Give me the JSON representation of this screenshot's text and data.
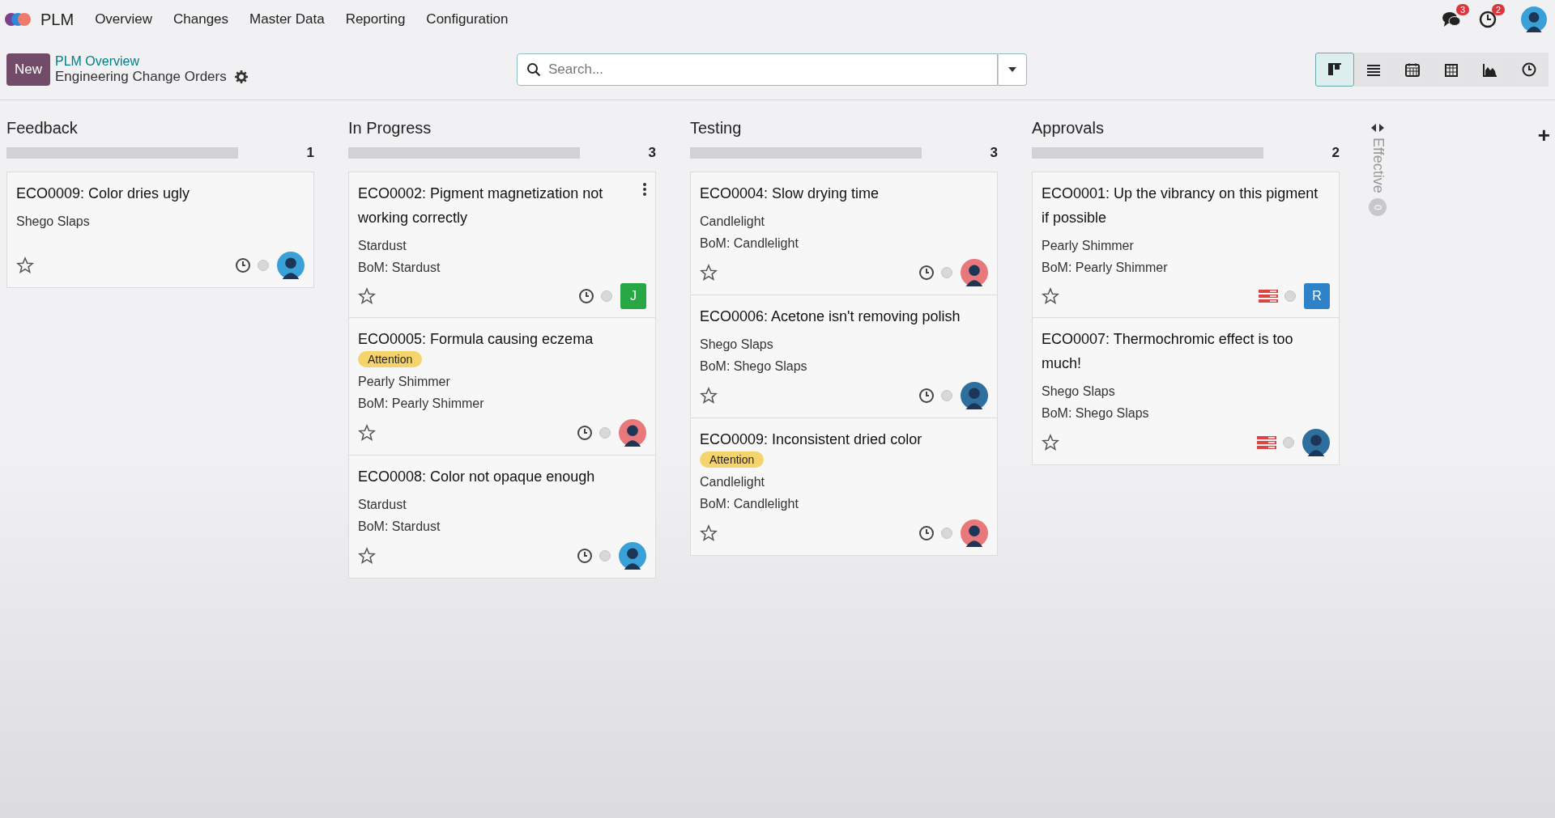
{
  "navbar": {
    "app": "PLM",
    "menu": [
      "Overview",
      "Changes",
      "Master Data",
      "Reporting",
      "Configuration"
    ],
    "messages_badge": "3",
    "activities_badge": "2"
  },
  "control_panel": {
    "new_button": "New",
    "breadcrumb": "PLM Overview",
    "title": "Engineering Change Orders",
    "search": {
      "placeholder": "Search..."
    },
    "views": [
      {
        "kind": "kanban",
        "selected": true
      },
      {
        "kind": "list",
        "selected": false
      },
      {
        "kind": "calendar",
        "selected": false
      },
      {
        "kind": "pivot",
        "selected": false
      },
      {
        "kind": "graph",
        "selected": false
      },
      {
        "kind": "activity",
        "selected": false
      }
    ]
  },
  "columns": [
    {
      "name": "Feedback",
      "count": "1",
      "level": 0,
      "cards": [
        {
          "title": "ECO0009: Color dries ugly",
          "product": "Shego Slaps",
          "menu": false,
          "activity": {
            "kind": "clock"
          },
          "avatar": {
            "kind": "photo",
            "color": "#3aa0d8"
          }
        }
      ]
    },
    {
      "name": "In Progress",
      "count": "3",
      "level": 0,
      "cards": [
        {
          "title": "ECO0002: Pigment magnetization not working correctly",
          "product": "Stardust",
          "bom": "BoM: Stardust",
          "menu": true,
          "activity": {
            "kind": "clock"
          },
          "avatar": {
            "kind": "letter",
            "letter": "J",
            "color": "#28a745"
          }
        },
        {
          "title": "ECO0005: Formula causing eczema",
          "tag": "Attention",
          "product": "Pearly Shimmer",
          "bom": "BoM: Pearly Shimmer",
          "menu": false,
          "activity": {
            "kind": "clock"
          },
          "avatar": {
            "kind": "photo",
            "color": "#e8787a"
          }
        },
        {
          "title": "ECO0008: Color not opaque enough",
          "product": "Stardust",
          "bom": "BoM: Stardust",
          "menu": false,
          "activity": {
            "kind": "clock"
          },
          "avatar": {
            "kind": "photo",
            "color": "#3aa0d8"
          }
        }
      ]
    },
    {
      "name": "Testing",
      "count": "3",
      "level": 0,
      "cards": [
        {
          "title": "ECO0004: Slow drying time",
          "product": "Candlelight",
          "bom": "BoM: Candlelight",
          "menu": false,
          "activity": {
            "kind": "clock"
          },
          "avatar": {
            "kind": "photo",
            "color": "#e8787a"
          }
        },
        {
          "title": "ECO0006: Acetone isn't removing polish",
          "product": "Shego Slaps",
          "bom": "BoM: Shego Slaps",
          "menu": false,
          "activity": {
            "kind": "clock"
          },
          "avatar": {
            "kind": "photo",
            "color": "#2e6f9e"
          }
        },
        {
          "title": "ECO0009: Inconsistent dried color",
          "tag": "Attention",
          "product": "Candlelight",
          "bom": "BoM: Candlelight",
          "menu": false,
          "activity": {
            "kind": "clock"
          },
          "avatar": {
            "kind": "photo",
            "color": "#e8787a"
          }
        }
      ]
    },
    {
      "name": "Approvals",
      "count": "2",
      "level": 0,
      "cards": [
        {
          "title": "ECO0001: Up the vibrancy on this pigment if possible",
          "product": "Pearly Shimmer",
          "bom": "BoM: Pearly Shimmer",
          "menu": false,
          "activity": {
            "kind": "list"
          },
          "avatar": {
            "kind": "letter",
            "letter": "R",
            "color": "#2d82c8"
          }
        },
        {
          "title": "ECO0007: Thermochromic effect is too much!",
          "product": "Shego Slaps",
          "bom": "BoM: Shego Slaps",
          "menu": false,
          "activity": {
            "kind": "list"
          },
          "avatar": {
            "kind": "photo",
            "color": "#2e6f9e"
          }
        }
      ]
    }
  ],
  "folded_column": {
    "name": "Effective",
    "count": "0"
  },
  "add_column": "+"
}
